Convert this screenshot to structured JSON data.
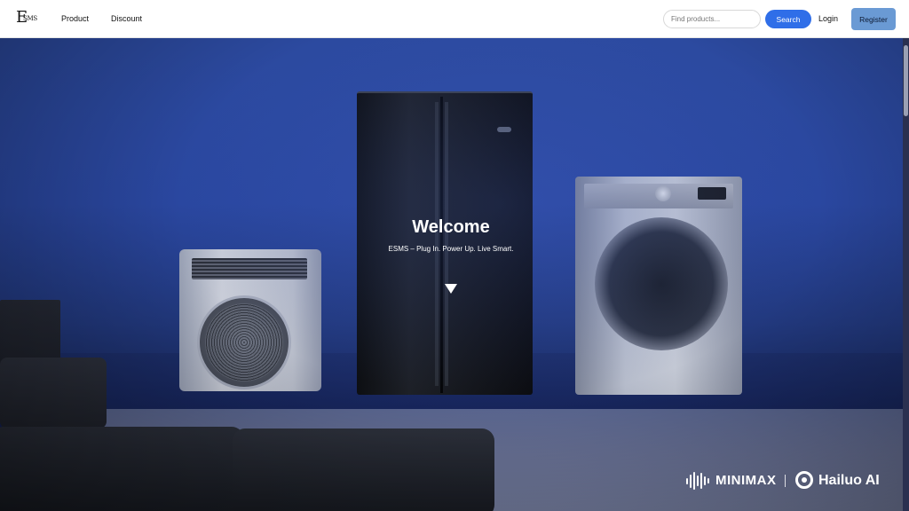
{
  "brand": {
    "logo_big": "E",
    "logo_small": "SMS"
  },
  "nav": {
    "product_label": "Product",
    "discount_label": "Discount",
    "search_placeholder": "Find products...",
    "search_label": "Search",
    "login_label": "Login",
    "register_label": "Register"
  },
  "hero": {
    "title": "Welcome",
    "subtitle": "ESMS – Plug In. Power Up. Live Smart.",
    "scroll_icon": "triangle-down-icon"
  },
  "watermark": {
    "brand1": "MINIMAX",
    "brand2": "Hailuo AI"
  },
  "colors": {
    "search_button": "#2f6ee8",
    "register_button": "#6a9ad4",
    "hero_background": "#2a47a0"
  }
}
